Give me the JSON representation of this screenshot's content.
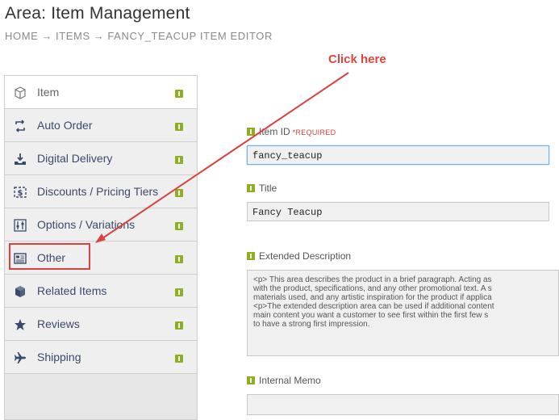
{
  "header": {
    "title": "Area: Item Management",
    "breadcrumb": [
      "HOME",
      "ITEMS",
      "FANCY_TEACUP ITEM EDITOR"
    ],
    "separator": "→"
  },
  "sidebar": {
    "items": [
      {
        "label": "Item",
        "icon": "cube-outline-icon"
      },
      {
        "label": "Auto Order",
        "icon": "repeat-icon"
      },
      {
        "label": "Digital Delivery",
        "icon": "download-tray-icon"
      },
      {
        "label": "Discounts / Pricing Tiers",
        "icon": "dollar-tag-icon"
      },
      {
        "label": "Options / Variations",
        "icon": "sliders-icon"
      },
      {
        "label": "Other",
        "icon": "list-alt-icon"
      },
      {
        "label": "Related Items",
        "icon": "cubes-icon"
      },
      {
        "label": "Reviews",
        "icon": "star-icon"
      },
      {
        "label": "Shipping",
        "icon": "plane-icon"
      }
    ],
    "active_index": 0,
    "highlighted_index": 5
  },
  "form": {
    "item_id": {
      "label": "Item ID",
      "required": "*REQUIRED",
      "value": "fancy_teacup"
    },
    "title": {
      "label": "Title",
      "value": "Fancy Teacup"
    },
    "extended_description": {
      "label": "Extended Description",
      "value": "<p> This area describes the product in a brief paragraph. Acting as\nwith the product, specifications, and any other promotional text. A s\nmaterials used, and any artistic inspiration for the product if applica\n<p>The extended description area can be used if additional content\nmain content you want a customer to see first within the first few s\nto have a strong first impression."
    },
    "internal_memo": {
      "label": "Internal Memo",
      "value": ""
    }
  },
  "annotation": {
    "text": "Click here"
  },
  "colors": {
    "accent_red": "#d9423e",
    "badge_green": "#8cb021",
    "link_blue": "#3a4a6b"
  }
}
